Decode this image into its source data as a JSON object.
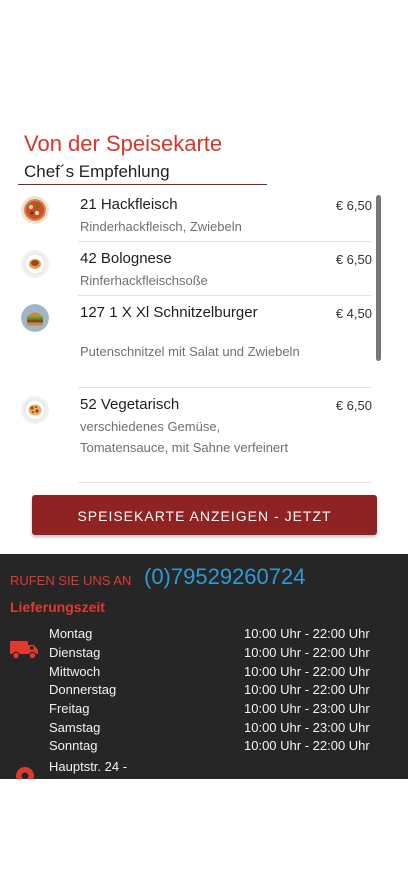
{
  "menu": {
    "title": "Von der Speisekarte",
    "subtitle": "Chef´s Empfehlung",
    "items": [
      {
        "name": "21 Hackfleisch",
        "description": "Rinderhackfleisch, Zwiebeln",
        "price": "€ 6,50",
        "image": "pizza-image"
      },
      {
        "name": "42 Bolognese",
        "description": "Rinferhackfleischsoße",
        "price": "€ 6,50",
        "image": "pasta-bolognese-image"
      },
      {
        "name": "127 1 X Xl Schnitzelburger",
        "description": "Putenschnitzel mit Salat und Zwiebeln",
        "price": "€ 4,50",
        "image": "burger-image"
      },
      {
        "name": "52 Vegetarisch",
        "description": "verschiedenes Gemüse, Tomatensauce, mit Sahne verfeinert",
        "price": "€ 6,50",
        "image": "vegetarian-pasta-image"
      }
    ],
    "cta_label": "SPEISEKARTE ANZEIGEN - JETZT"
  },
  "contact": {
    "call_label": "RUFEN SIE UNS AN",
    "phone": "(0)79529260724"
  },
  "delivery": {
    "title": "Lieferungszeit",
    "hours": [
      {
        "day": "Montag",
        "time": "10:00 Uhr - 22:00 Uhr"
      },
      {
        "day": "Dienstag",
        "time": "10:00 Uhr - 22:00 Uhr"
      },
      {
        "day": "Mittwoch",
        "time": "10:00 Uhr - 22:00 Uhr"
      },
      {
        "day": "Donnerstag",
        "time": "10:00 Uhr - 22:00 Uhr"
      },
      {
        "day": "Freitag",
        "time": "10:00 Uhr - 23:00 Uhr"
      },
      {
        "day": "Samstag",
        "time": "10:00 Uhr - 23:00 Uhr"
      },
      {
        "day": "Sonntag",
        "time": "10:00 Uhr - 22:00 Uhr"
      }
    ]
  },
  "address": {
    "street": "Hauptstr. 24 -"
  },
  "colors": {
    "accent_red": "#d9352b",
    "button_red": "#8f2222",
    "phone_blue": "#2e9bd6",
    "footer_bg": "#262626"
  },
  "icons": {
    "delivery": "delivery-truck-icon",
    "location": "location-pin-icon"
  }
}
